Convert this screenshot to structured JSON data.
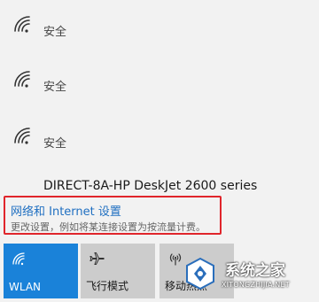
{
  "networks": [
    {
      "status": "安全",
      "icon": "wifi-secured-icon"
    },
    {
      "status": "安全",
      "icon": "wifi-secured-icon"
    },
    {
      "status": "安全",
      "icon": "wifi-secured-icon"
    },
    {
      "name": "DIRECT-8A-HP DeskJet 2600 series",
      "icon": "wifi-icon"
    }
  ],
  "settings": {
    "title": "网络和 Internet 设置",
    "description": "更改设置，例如将某连接设置为按流量计费。"
  },
  "quick_actions": [
    {
      "label": "WLAN",
      "icon": "wifi-icon",
      "active": true
    },
    {
      "label": "飞行模式",
      "icon": "airplane-icon",
      "active": false
    },
    {
      "label": "移动热点",
      "icon": "hotspot-icon",
      "active": false
    }
  ],
  "watermark": {
    "name": "系统之家",
    "url": "XITONGZHIJIA.NET"
  },
  "colors": {
    "accent": "#1a82d9",
    "link": "#1f6fc1",
    "highlight_border": "#e0252b",
    "panel_bg": "#f2f2f2",
    "tile_bg": "#cccccc"
  }
}
